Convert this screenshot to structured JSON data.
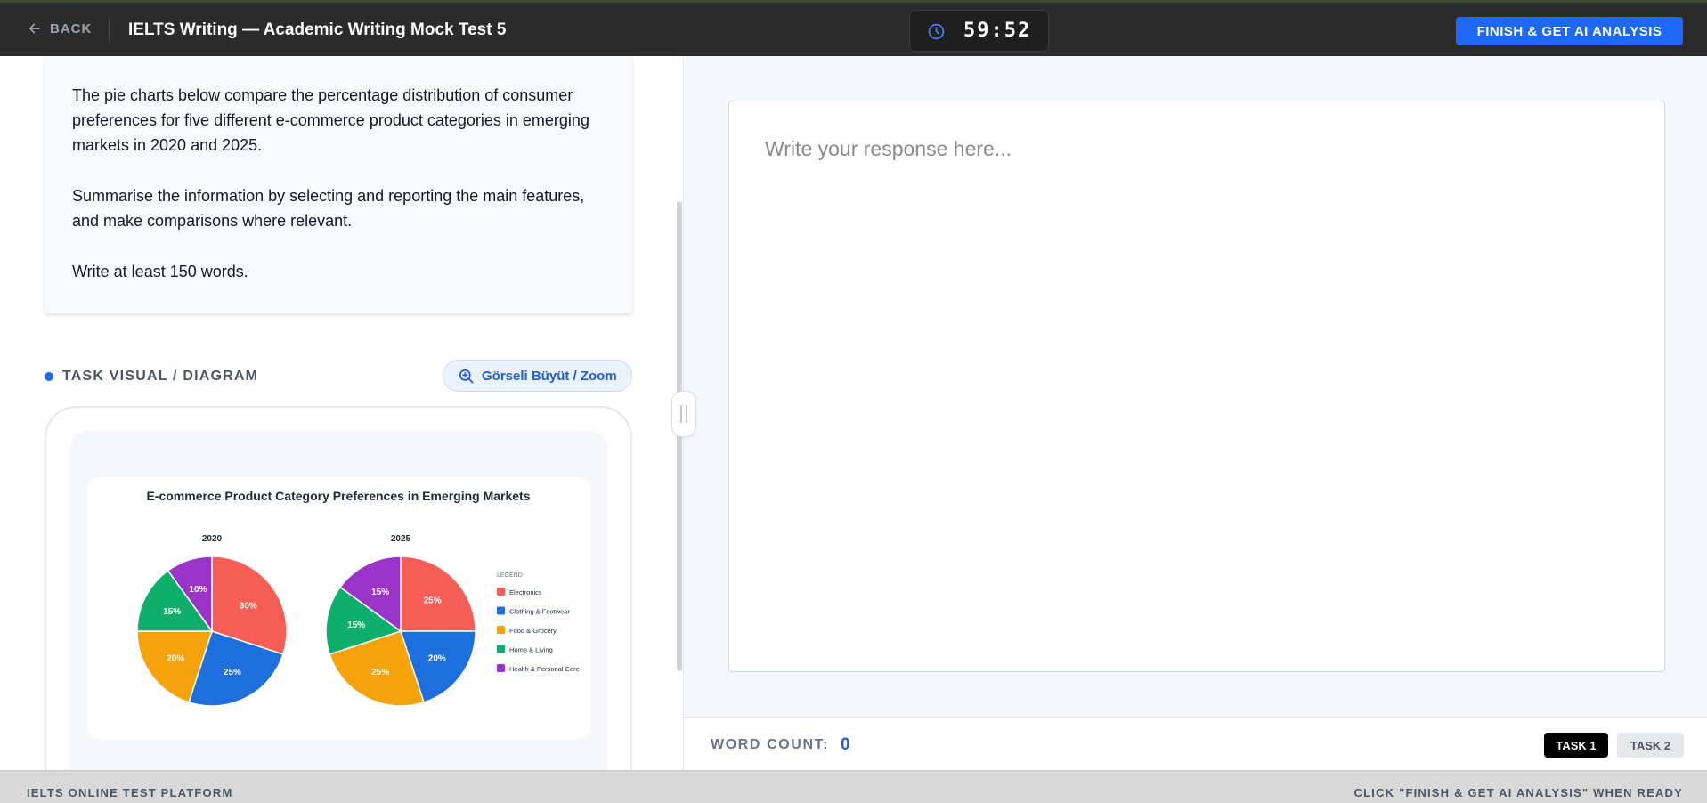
{
  "header": {
    "back_label": "BACK",
    "title": "IELTS Writing — Academic Writing Mock Test 5",
    "timer": "59:52",
    "finish_label": "FINISH & GET AI ANALYSIS"
  },
  "task": {
    "paragraphs": [
      "The pie charts below compare the percentage distribution of consumer preferences for five different e-commerce product categories in emerging markets in 2020 and 2025.",
      "Summarise the information by selecting and reporting the main features, and make comparisons where relevant.",
      "Write at least 150 words."
    ]
  },
  "visual": {
    "section_title": "TASK VISUAL / DIAGRAM",
    "zoom_label": "Görseli Büyüt / Zoom"
  },
  "chart_data": {
    "type": "pie",
    "title": "E-commerce Product Category Preferences in Emerging Markets",
    "legend_title": "LEGEND",
    "legend_position": "right",
    "categories": [
      "Electronics",
      "Clothing & Footwear",
      "Food & Grocery",
      "Home & Living",
      "Health & Personal Care"
    ],
    "colors": [
      "#f65d55",
      "#1c6fdd",
      "#f6a20a",
      "#0fae6a",
      "#9a34c8"
    ],
    "series": [
      {
        "name": "2020",
        "values": [
          30,
          25,
          20,
          15,
          10
        ]
      },
      {
        "name": "2025",
        "values": [
          25,
          20,
          25,
          15,
          15
        ]
      }
    ]
  },
  "editor": {
    "placeholder": "Write your response here..."
  },
  "footer": {
    "word_count_label": "WORD COUNT:",
    "word_count": "0",
    "task_tabs": [
      "TASK 1",
      "TASK 2"
    ]
  },
  "statusbar": {
    "left": "IELTS ONLINE TEST PLATFORM",
    "right": "CLICK \"FINISH & GET AI ANALYSIS\" WHEN READY"
  }
}
